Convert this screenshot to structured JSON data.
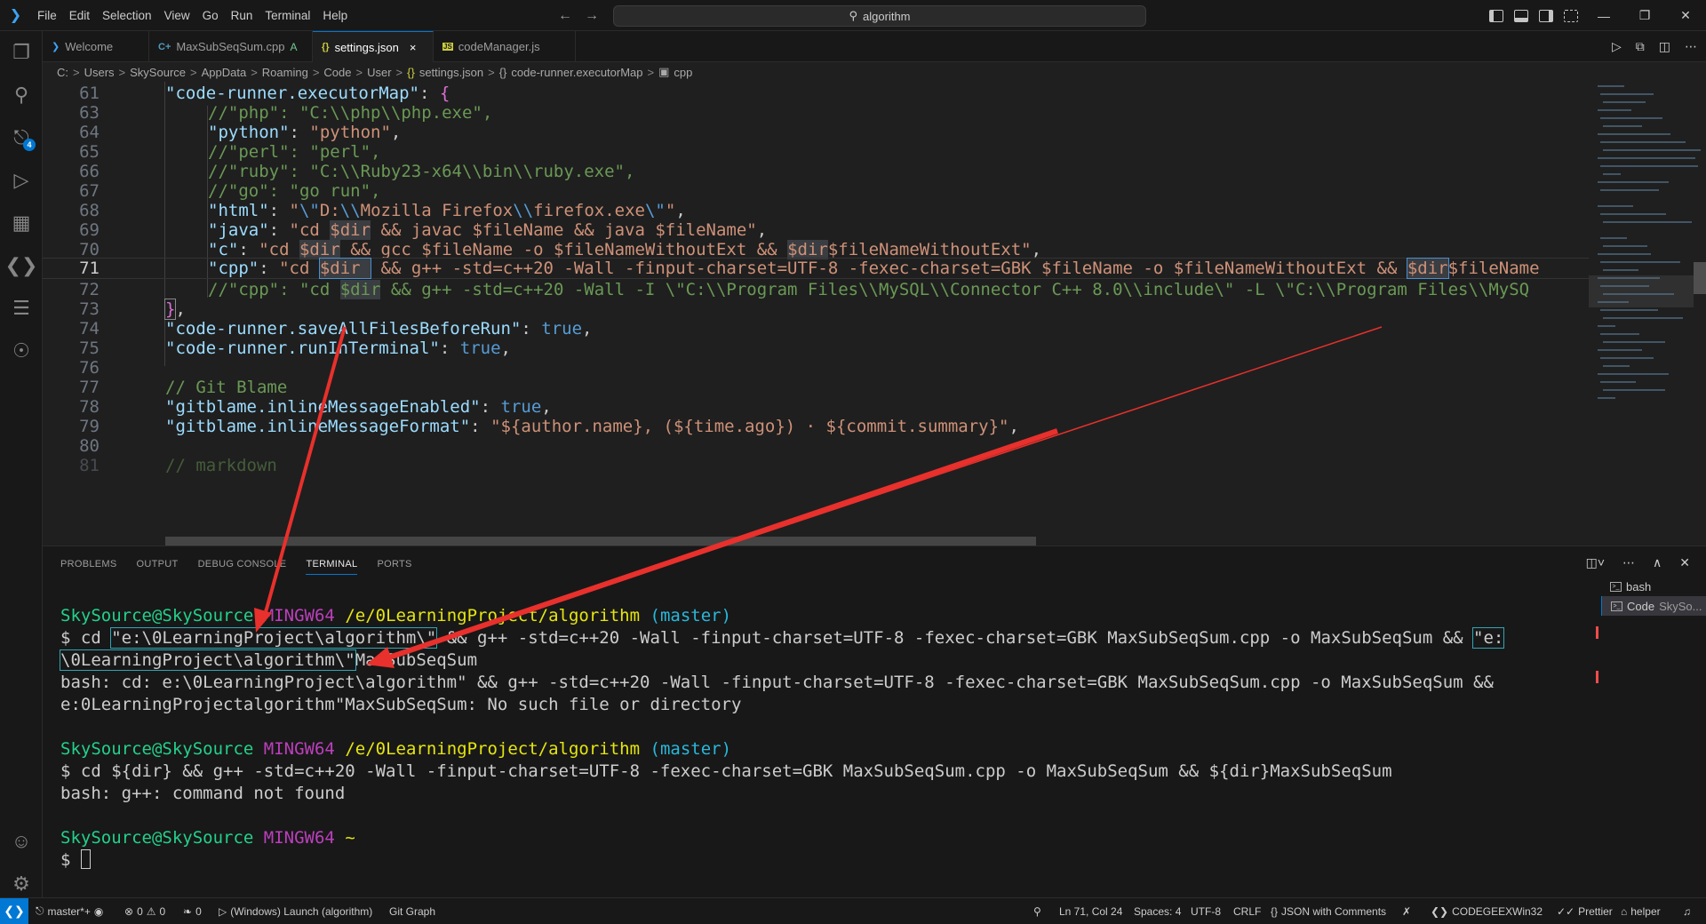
{
  "titlebar": {
    "menus": [
      "File",
      "Edit",
      "Selection",
      "View",
      "Go",
      "Run",
      "Terminal",
      "Help"
    ],
    "search_text": "algorithm"
  },
  "activity_bar": {
    "items": [
      "explorer-icon",
      "search-icon",
      "source-control-icon",
      "run-debug-icon",
      "extensions-icon",
      "remote-explorer-icon",
      "git-graph-icon",
      "codegeex-icon",
      "accounts-icon",
      "settings-gear-icon"
    ],
    "source_control_badge": "4"
  },
  "tabs": [
    {
      "label": "Welcome",
      "icon": "vscode-icon",
      "active": false
    },
    {
      "label": "MaxSubSeqSum.cpp",
      "icon": "cpp-icon",
      "modified": "A",
      "active": false
    },
    {
      "label": "settings.json",
      "icon": "json-icon",
      "active": true,
      "close": "×"
    },
    {
      "label": "codeManager.js",
      "icon": "js-icon",
      "active": false
    }
  ],
  "breadcrumb": [
    "C:",
    "Users",
    "SkySource",
    "AppData",
    "Roaming",
    "Code",
    "User",
    "settings.json",
    "code-runner.executorMap",
    "cpp"
  ],
  "editor": {
    "current_line": 71,
    "lines": [
      {
        "n": "61",
        "t": "\"code-runner.executorMap\": {"
      },
      {
        "n": "63",
        "t": "//\"php\": \"C:\\\\php\\\\php.exe\","
      },
      {
        "n": "64",
        "t": "\"python\": \"python\","
      },
      {
        "n": "65",
        "t": "//\"perl\": \"perl\","
      },
      {
        "n": "66",
        "t": "//\"ruby\": \"C:\\\\Ruby23-x64\\\\bin\\\\ruby.exe\","
      },
      {
        "n": "67",
        "t": "//\"go\": \"go run\","
      },
      {
        "n": "68",
        "t": "\"html\": \"\\\"D:\\\\Mozilla Firefox\\\\firefox.exe\\\"\","
      },
      {
        "n": "69",
        "t": "\"java\": \"cd $dir && javac $fileName && java $fileName\","
      },
      {
        "n": "70",
        "t": "\"c\": \"cd $dir && gcc $fileName -o $fileNameWithoutExt && $dir$fileNameWithoutExt\","
      },
      {
        "n": "71",
        "t": "\"cpp\": \"cd $dir && g++ -std=c++20 -Wall -finput-charset=UTF-8 -fexec-charset=GBK $fileName -o $fileNameWithoutExt && $dir$fileName"
      },
      {
        "n": "72",
        "t": "//\"cpp\": \"cd $dir && g++ -std=c++20 -Wall -I \\\"C:\\\\Program Files\\\\MySQL\\\\Connector C++ 8.0\\\\include\\\" -L \\\"C:\\\\Program Files\\\\MySQ"
      },
      {
        "n": "73",
        "t": "},"
      },
      {
        "n": "74",
        "t": "\"code-runner.saveAllFilesBeforeRun\": true,"
      },
      {
        "n": "75",
        "t": "\"code-runner.runInTerminal\": true,"
      },
      {
        "n": "76",
        "t": ""
      },
      {
        "n": "77",
        "t": "// Git Blame"
      },
      {
        "n": "78",
        "t": "\"gitblame.inlineMessageEnabled\": true,"
      },
      {
        "n": "79",
        "t": "\"gitblame.inlineMessageFormat\": \"${author.name}, (${time.ago}) · ${commit.summary}\","
      },
      {
        "n": "80",
        "t": ""
      },
      {
        "n": "81",
        "t": "// markdown"
      }
    ]
  },
  "panel": {
    "tabs": [
      "PROBLEMS",
      "OUTPUT",
      "DEBUG CONSOLE",
      "TERMINAL",
      "PORTS"
    ],
    "active_tab": "TERMINAL",
    "terminals": [
      {
        "name": "bash",
        "sub": ""
      },
      {
        "name": "Code",
        "sub": "SkySo..."
      }
    ],
    "prompt": {
      "user": "SkySource@SkySource",
      "shell": "MINGW64",
      "path": "/e/0LearningProject/algorithm",
      "branch": "(master)"
    },
    "out": {
      "cmd1_a": "$ cd ",
      "cmd1_q1": "\"e:\\0LearningProject\\algorithm\\\"",
      "cmd1_b": " && g++ -std=c++20 -Wall -finput-charset=UTF-8 -fexec-charset=GBK MaxSubSeqSum.cpp -o MaxSubSeqSum && ",
      "cmd1_q2": "\"e:",
      "cmd1_c": "\\0LearningProject\\algorithm\\\"",
      "cmd1_d": "MaxSubSeqSum",
      "err1_a": "bash: cd: e:\\0LearningProject\\algorithm\" && g++ -std=c++20 -Wall -finput-charset=UTF-8 -fexec-charset=GBK MaxSubSeqSum.cpp -o MaxSubSeqSum &&",
      "err1_b": "e:0LearningProjectalgorithm\"MaxSubSeqSum: No such file or directory",
      "cmd2": "$ cd ${dir} && g++ -std=c++20 -Wall -finput-charset=UTF-8 -fexec-charset=GBK MaxSubSeqSum.cpp -o MaxSubSeqSum && ${dir}MaxSubSeqSum",
      "err2": "bash: g++: command not found",
      "prompt3_path": "~",
      "prompt_symbol": "$ "
    }
  },
  "statusbar": {
    "branch": "master*+",
    "errors": "0",
    "warnings": "0",
    "ports": "0",
    "launch": "(Windows) Launch (algorithm)",
    "git_graph": "Git Graph",
    "position": "Ln 71, Col 24",
    "spaces": "Spaces: 4",
    "encoding": "UTF-8",
    "eol": "CRLF",
    "language": "JSON with Comments",
    "codegeex": "CODEGEEX",
    "platform": "Win32",
    "prettier": "Prettier",
    "helper": "helper"
  },
  "colors": {
    "accent": "#0078d4",
    "annotation": "#e8302c"
  }
}
